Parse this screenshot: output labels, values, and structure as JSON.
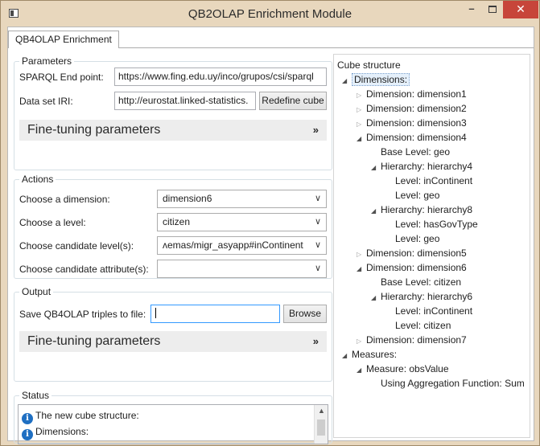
{
  "window": {
    "title": "QB2OLAP Enrichment Module"
  },
  "tab": {
    "label": "QB4OLAP Enrichment"
  },
  "parameters": {
    "group_label": "Parameters",
    "sparql_label": "SPARQL End point:",
    "sparql_value": "https://www.fing.edu.uy/inco/grupos/csi/sparql",
    "dataset_label": "Data set IRI:",
    "dataset_value": "http://eurostat.linked-statistics.",
    "redefine_button": "Redefine cube",
    "fine_tuning": "Fine-tuning parameters"
  },
  "actions": {
    "group_label": "Actions",
    "dimension_label": "Choose a dimension:",
    "dimension_value": "dimension6",
    "level_label": "Choose a level:",
    "level_value": "citizen",
    "candidate_level_label": "Choose candidate level(s):",
    "candidate_level_value": "ʌemas/migr_asyapp#inContinent",
    "candidate_attr_label": "Choose candidate attribute(s):",
    "candidate_attr_value": ""
  },
  "output": {
    "group_label": "Output",
    "save_label": "Save QB4OLAP triples to file:",
    "save_value": "",
    "browse_button": "Browse",
    "fine_tuning": "Fine-tuning parameters"
  },
  "status": {
    "group_label": "Status",
    "lines": [
      "The new cube structure:",
      "Dimensions:"
    ]
  },
  "tree": {
    "title": "Cube structure",
    "nodes": [
      {
        "text": "Dimensions:",
        "indent": 0,
        "state": "open"
      },
      {
        "text": "Dimension: dimension1",
        "indent": 1,
        "state": "closed"
      },
      {
        "text": "Dimension: dimension2",
        "indent": 1,
        "state": "closed"
      },
      {
        "text": "Dimension: dimension3",
        "indent": 1,
        "state": "closed"
      },
      {
        "text": "Dimension: dimension4",
        "indent": 1,
        "state": "open"
      },
      {
        "text": "Base Level: geo",
        "indent": 2,
        "state": "leaf"
      },
      {
        "text": "Hierarchy: hierarchy4",
        "indent": 2,
        "state": "open"
      },
      {
        "text": "Level: inContinent",
        "indent": 3,
        "state": "leaf"
      },
      {
        "text": "Level: geo",
        "indent": 3,
        "state": "leaf"
      },
      {
        "text": "Hierarchy: hierarchy8",
        "indent": 2,
        "state": "open"
      },
      {
        "text": "Level: hasGovType",
        "indent": 3,
        "state": "leaf"
      },
      {
        "text": "Level: geo",
        "indent": 3,
        "state": "leaf"
      },
      {
        "text": "Dimension: dimension5",
        "indent": 1,
        "state": "closed"
      },
      {
        "text": "Dimension: dimension6",
        "indent": 1,
        "state": "open"
      },
      {
        "text": "Base Level: citizen",
        "indent": 2,
        "state": "leaf"
      },
      {
        "text": "Hierarchy: hierarchy6",
        "indent": 2,
        "state": "open"
      },
      {
        "text": "Level: inContinent",
        "indent": 3,
        "state": "leaf"
      },
      {
        "text": "Level: citizen",
        "indent": 3,
        "state": "leaf"
      },
      {
        "text": "Dimension: dimension7",
        "indent": 1,
        "state": "closed"
      },
      {
        "text": "Measures:",
        "indent": 0,
        "state": "open"
      },
      {
        "text": "Measure: obsValue",
        "indent": 1,
        "state": "open"
      },
      {
        "text": "Using Aggregation Function: Sum",
        "indent": 2,
        "state": "leaf"
      }
    ]
  }
}
